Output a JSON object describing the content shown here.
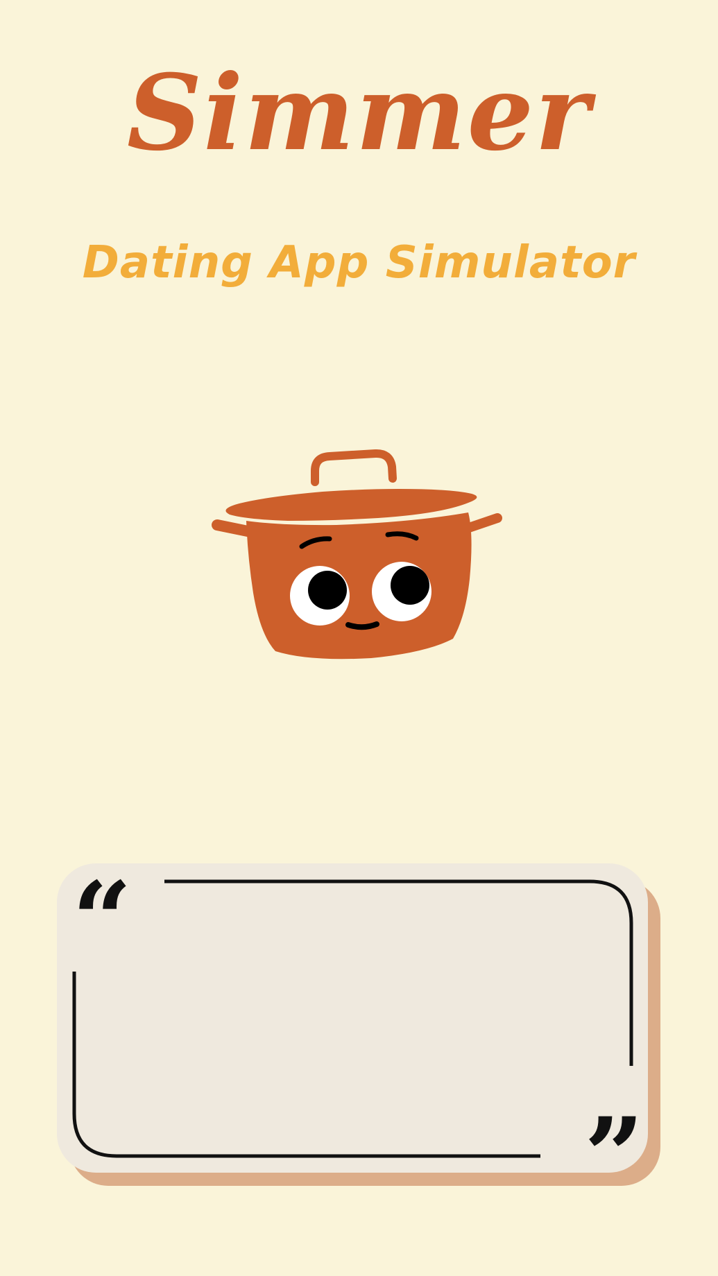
{
  "app": {
    "title": "Simmer",
    "subtitle": "Dating App Simulator"
  },
  "mascot": {
    "icon": "cooking-pot-mascot-icon"
  },
  "quote_card": {
    "open_mark": "“",
    "close_mark": "”",
    "text": ""
  },
  "colors": {
    "background": "#faf4d9",
    "title": "#cd5f2b",
    "subtitle": "#f2ad3a",
    "pot": "#cd5f2b",
    "card": "#efe9de",
    "card_shadow": "#dcad89"
  }
}
